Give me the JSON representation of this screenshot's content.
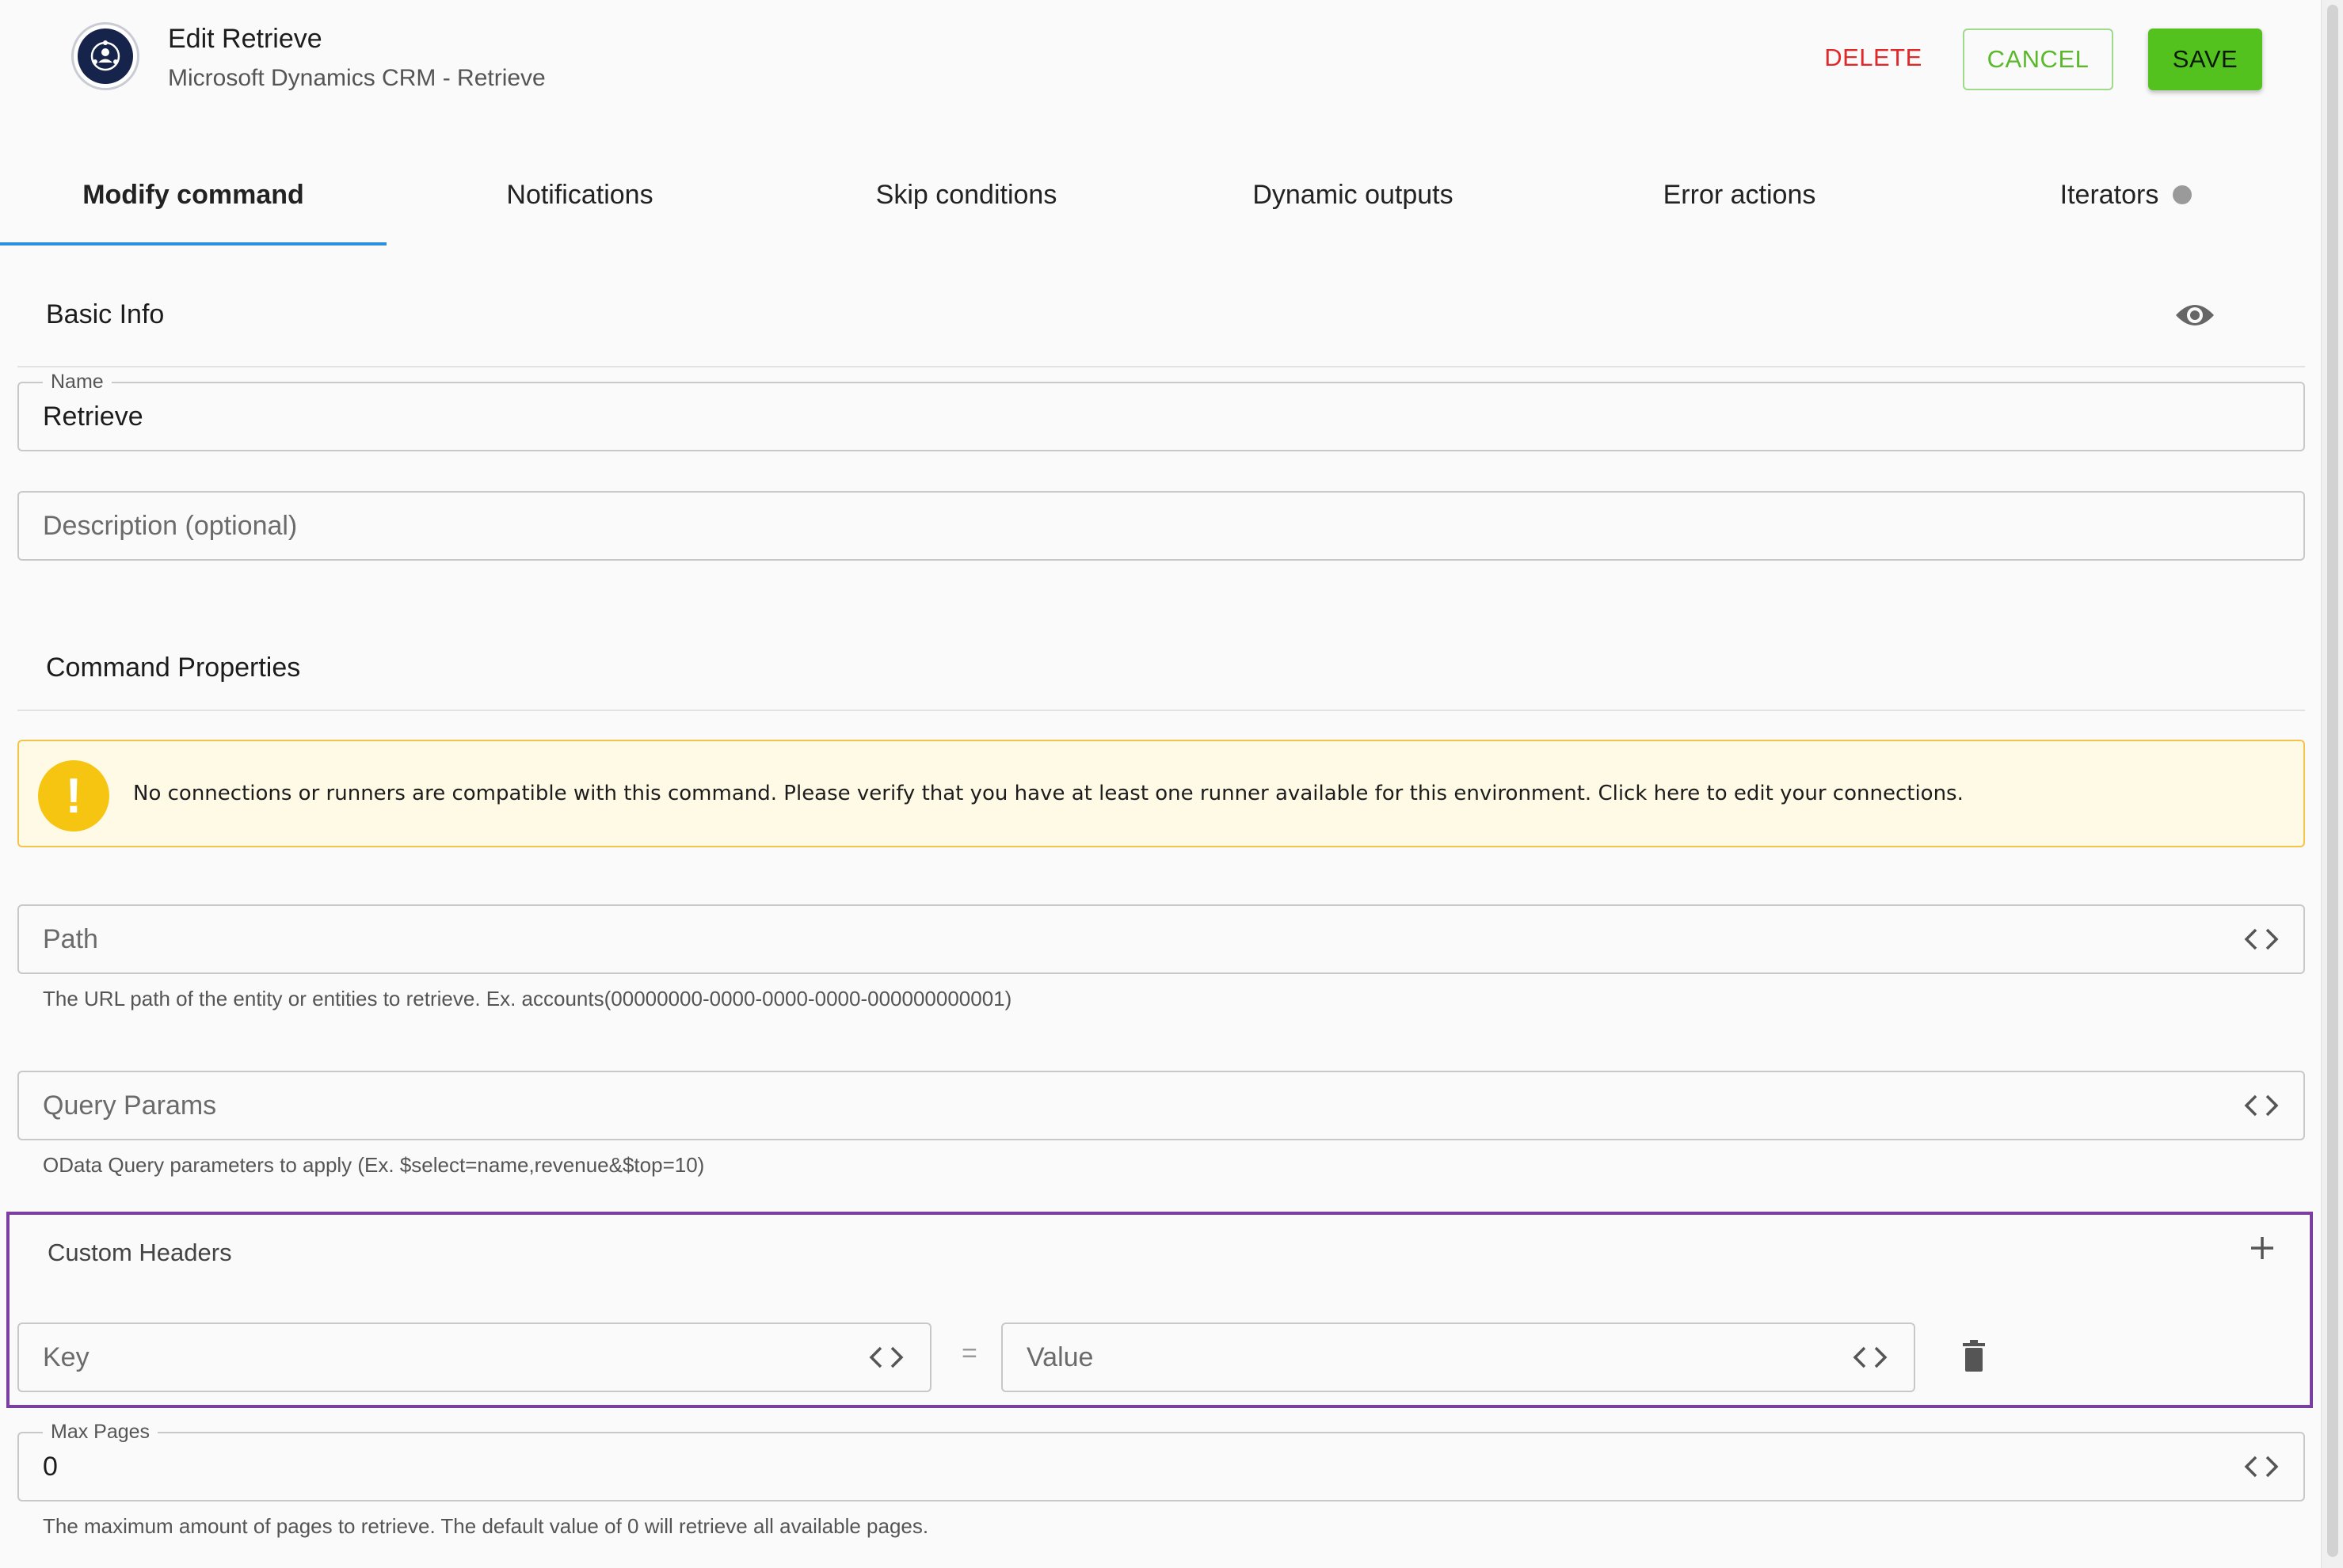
{
  "header": {
    "title": "Edit Retrieve",
    "subtitle": "Microsoft Dynamics CRM - Retrieve",
    "logo_icon": "connector-logo-icon",
    "delete_label": "DELETE",
    "cancel_label": "CANCEL",
    "save_label": "SAVE"
  },
  "tabs": [
    {
      "label": "Modify command",
      "active": true
    },
    {
      "label": "Notifications"
    },
    {
      "label": "Skip conditions"
    },
    {
      "label": "Dynamic outputs"
    },
    {
      "label": "Error actions"
    },
    {
      "label": "Iterators",
      "status_dot": true
    }
  ],
  "basic_info": {
    "title": "Basic Info",
    "visibility_icon": "eye-icon",
    "name_label": "Name",
    "name_value": "Retrieve",
    "description_placeholder": "Description (optional)"
  },
  "command_properties": {
    "title": "Command Properties",
    "warning_text": "No connections or runners are compatible with this command. Please verify that you have at least one runner available for this environment. Click here to edit your connections.",
    "warning_icon": "exclamation-icon",
    "path_placeholder": "Path",
    "path_helper": "The URL path of the entity or entities to retrieve. Ex. accounts(00000000-0000-0000-0000-000000000001)",
    "query_placeholder": "Query Params",
    "query_helper": "OData Query parameters to apply (Ex. $select=name,revenue&$top=10)",
    "custom_headers": {
      "title": "Custom Headers",
      "key_placeholder": "Key",
      "equals": "=",
      "value_placeholder": "Value"
    },
    "max_pages_label": "Max Pages",
    "max_pages_value": "0",
    "max_pages_helper": "The maximum amount of pages to retrieve. The default value of 0 will retrieve all available pages."
  },
  "colors": {
    "accent_tab": "#2d8ee0",
    "delete": "#e0292b",
    "save": "#54c21e",
    "highlight_box": "#7a3fa0",
    "warning_bg": "#fffae5"
  }
}
